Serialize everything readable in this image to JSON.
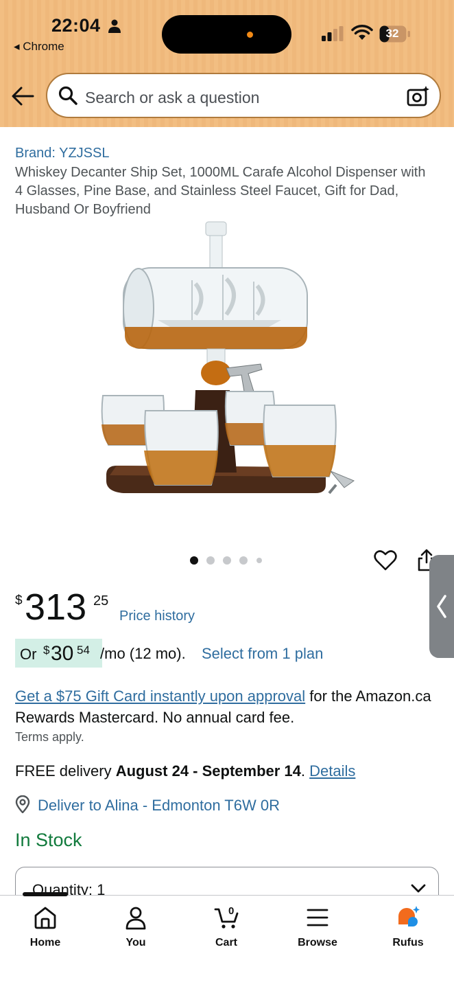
{
  "status_bar": {
    "time": "22:04",
    "back_app": "◂ Chrome",
    "battery": "32"
  },
  "search": {
    "placeholder": "Search or ask a question"
  },
  "product": {
    "brand": "Brand: YZJSSL",
    "title": "Whiskey Decanter Ship Set, 1000ML Carafe Alcohol Dispenser with 4 Glasses, Pine Base, and Stainless Steel Faucet, Gift for Dad, Husband Or Boyfriend",
    "image_count": 5,
    "current_image": 1
  },
  "price": {
    "currency": "$",
    "whole": "313",
    "cents": "25",
    "history_label": "Price history"
  },
  "installment": {
    "or": "Or",
    "currency": "$",
    "whole": "30",
    "cents": "54",
    "rest": "/mo (12 mo).",
    "select_label": "Select from 1 plan"
  },
  "gift": {
    "link": "Get a $75 Gift Card instantly upon approval",
    "rest": " for the Amazon.ca Rewards Mastercard. No annual card fee.",
    "terms": "Terms apply."
  },
  "delivery": {
    "prefix": "FREE delivery ",
    "dates": "August 24 - September 14",
    "separator": ". ",
    "details_label": "Details",
    "deliver_to": "Deliver to Alina - Edmonton T6W 0R"
  },
  "stock": "In Stock",
  "quantity": {
    "label": "Quantity: 1"
  },
  "bottom_nav": {
    "items": [
      {
        "label": "Home",
        "icon": "home-icon"
      },
      {
        "label": "You",
        "icon": "person-icon"
      },
      {
        "label": "Cart",
        "icon": "cart-icon"
      },
      {
        "label": "Browse",
        "icon": "menu-icon"
      },
      {
        "label": "Rufus",
        "icon": "rufus-icon"
      }
    ],
    "cart_count": "0",
    "active": "Home"
  },
  "colors": {
    "header_bg": "#f2be82",
    "link": "#2f6d9f",
    "in_stock": "#117a3c",
    "installment_bg": "#d3efe6",
    "rufus_orange": "#f26b1d",
    "rufus_blue": "#1f8fe5"
  }
}
